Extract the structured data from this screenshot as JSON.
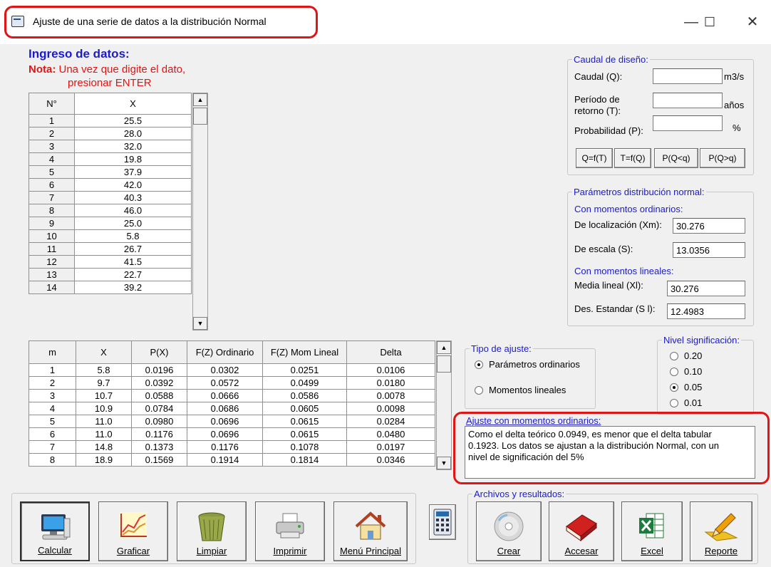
{
  "window": {
    "title": "Ajuste de una serie de datos a la distribución Normal",
    "min_glyph": "—",
    "max_glyph": "☐",
    "close_glyph": "✕"
  },
  "input": {
    "heading": "Ingreso de datos:",
    "note_label": "Nota:",
    "note_line1": "Una vez que digite el dato,",
    "note_line2": "presionar ENTER",
    "col_n": "N°",
    "col_x": "X",
    "rows": [
      {
        "n": "1",
        "x": "25.5"
      },
      {
        "n": "2",
        "x": "28.0"
      },
      {
        "n": "3",
        "x": "32.0"
      },
      {
        "n": "4",
        "x": "19.8"
      },
      {
        "n": "5",
        "x": "37.9"
      },
      {
        "n": "6",
        "x": "42.0"
      },
      {
        "n": "7",
        "x": "40.3"
      },
      {
        "n": "8",
        "x": "46.0"
      },
      {
        "n": "9",
        "x": "25.0"
      },
      {
        "n": "10",
        "x": "5.8"
      },
      {
        "n": "11",
        "x": "26.7"
      },
      {
        "n": "12",
        "x": "41.5"
      },
      {
        "n": "13",
        "x": "22.7"
      },
      {
        "n": "14",
        "x": "39.2"
      }
    ]
  },
  "results_table": {
    "headers": [
      "m",
      "X",
      "P(X)",
      "F(Z) Ordinario",
      "F(Z) Mom Lineal",
      "Delta"
    ],
    "rows": [
      [
        "1",
        "5.8",
        "0.0196",
        "0.0302",
        "0.0251",
        "0.0106"
      ],
      [
        "2",
        "9.7",
        "0.0392",
        "0.0572",
        "0.0499",
        "0.0180"
      ],
      [
        "3",
        "10.7",
        "0.0588",
        "0.0666",
        "0.0586",
        "0.0078"
      ],
      [
        "4",
        "10.9",
        "0.0784",
        "0.0686",
        "0.0605",
        "0.0098"
      ],
      [
        "5",
        "11.0",
        "0.0980",
        "0.0696",
        "0.0615",
        "0.0284"
      ],
      [
        "6",
        "11.0",
        "0.1176",
        "0.0696",
        "0.0615",
        "0.0480"
      ],
      [
        "7",
        "14.8",
        "0.1373",
        "0.1176",
        "0.1078",
        "0.0197"
      ],
      [
        "8",
        "18.9",
        "0.1569",
        "0.1914",
        "0.1814",
        "0.0346"
      ]
    ]
  },
  "caudal": {
    "legend": "Caudal de diseño:",
    "q_label": "Caudal (Q):",
    "q_value": "",
    "q_unit": "m3/s",
    "t_label_1": "Período de",
    "t_label_2": "retorno (T):",
    "t_value": "",
    "t_unit": "años",
    "p_label": "Probabilidad (P):",
    "p_value": "",
    "p_unit": "%",
    "buttons": [
      "Q=f(T)",
      "T=f(Q)",
      "P(Q<q)",
      "P(Q>q)"
    ]
  },
  "params": {
    "legend": "Parámetros distribución normal:",
    "ordinary_heading": "Con momentos ordinarios:",
    "loc_label": "De localización (Xm):",
    "loc_value": "30.276",
    "scale_label": "De escala (S):",
    "scale_value": "13.0356",
    "linear_heading": "Con momentos lineales:",
    "mean_label": "Media  lineal (Xl):",
    "mean_value": "30.276",
    "std_label": "Des. Estandar (S l):",
    "std_value": "12.4983"
  },
  "fit_type": {
    "legend": "Tipo de ajuste:",
    "options": [
      {
        "label": "Parámetros ordinarios",
        "selected": true
      },
      {
        "label": "Momentos lineales",
        "selected": false
      }
    ]
  },
  "significance": {
    "legend": "Nivel significación:",
    "options": [
      {
        "label": "0.20",
        "selected": false
      },
      {
        "label": "0.10",
        "selected": false
      },
      {
        "label": "0.05",
        "selected": true
      },
      {
        "label": "0.01",
        "selected": false
      }
    ]
  },
  "fit_result": {
    "label": "Ajuste con momentos ordinarios:",
    "line1": "Como el delta teórico 0.0949, es menor que el delta tabular",
    "line2": "0.1923. Los datos se ajustan a la distribución Normal, con un",
    "line3": "nivel de significación del 5%"
  },
  "toolbar": {
    "calcular": "Calcular",
    "graficar": "Graficar",
    "limpiar": "Limpiar",
    "imprimir": "Imprimir",
    "menu": "Menú Principal"
  },
  "files": {
    "legend": "Archivos y resultados:",
    "crear": "Crear",
    "accesar": "Accesar",
    "excel": "Excel",
    "reporte": "Reporte"
  },
  "colors": {
    "accent_blue": "#1a1ad2",
    "note_red": "#e01515",
    "highlight_red": "#e01515"
  }
}
